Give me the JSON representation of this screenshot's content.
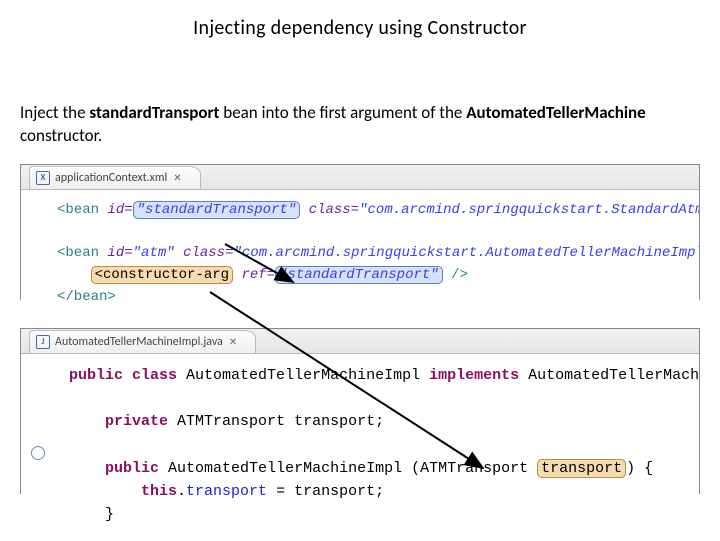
{
  "title": "Injecting dependency using Constructor",
  "intro_parts": {
    "p1": "Inject the ",
    "b1": "standardTransport",
    "p2": " bean into the first argument of the ",
    "b2": "AutomatedTellerMachine",
    "p3": " constructor."
  },
  "xml": {
    "tab": "applicationContext.xml",
    "tab_icon": "X",
    "bean1_id": "\"standardTransport\"",
    "bean1_class": "\"com.arcmind.springquickstart.StandardAtmTransport\"",
    "bean2_id": "\"atm\"",
    "bean2_class": "\"com.arcmind.springquickstart.AutomatedTellerMachineImpl\"",
    "carg_tag": "<constructor-arg",
    "carg_ref": "\"standardTransport\""
  },
  "java": {
    "tab": "AutomatedTellerMachineImpl.java",
    "tab_icon": "J",
    "class_name": "AutomatedTellerMachineImpl",
    "iface_name": "AutomatedTellerMachine",
    "field_type": "ATMTransport",
    "field_name": "transport",
    "param_type": "ATMTransport",
    "param_name": "transport",
    "assign_lhs": "transport",
    "assign_rhs": "transport"
  }
}
